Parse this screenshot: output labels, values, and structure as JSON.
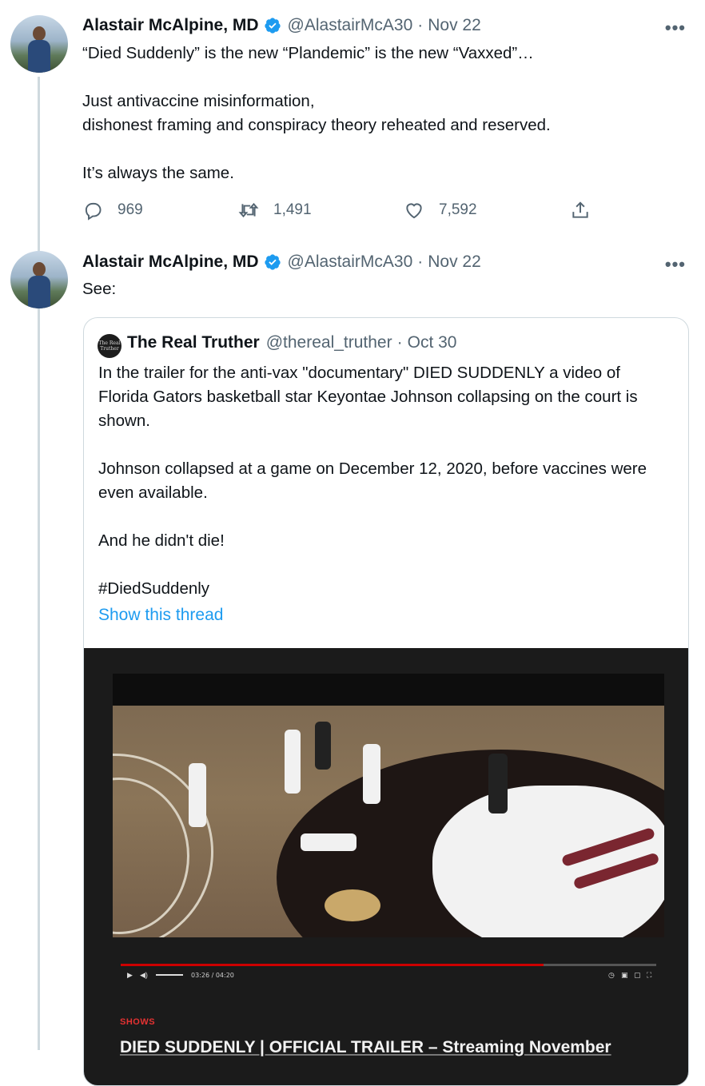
{
  "colors": {
    "accent": "#1d9bf0",
    "text": "#0f1419",
    "secondary": "#536471",
    "thread_line": "#cfd9de",
    "media_bg": "#1b1b1b",
    "card_label": "#e63232"
  },
  "tweets": [
    {
      "author_name": "Alastair McAlpine, MD",
      "verified_icon": "verified-badge-icon",
      "handle": "@AlastairMcA30",
      "separator": "·",
      "date": "Nov 22",
      "more_label": "•••",
      "text": "“Died Suddenly” is the new “Plandemic” is the new “Vaxxed”…\n\nJust antivaccine misinformation,\ndishonest framing and conspiracy theory reheated and reserved.\n\nIt’s always the same.",
      "actions": {
        "reply": {
          "icon": "reply-icon",
          "count": "969"
        },
        "retweet": {
          "icon": "retweet-icon",
          "count": "1,491"
        },
        "like": {
          "icon": "heart-icon",
          "count": "7,592"
        },
        "share": {
          "icon": "share-icon"
        }
      }
    },
    {
      "author_name": "Alastair McAlpine, MD",
      "verified_icon": "verified-badge-icon",
      "handle": "@AlastairMcA30",
      "separator": "·",
      "date": "Nov 22",
      "more_label": "•••",
      "text": "See:"
    }
  ],
  "quoted_tweet": {
    "avatar_text": "The Real Truther",
    "author_name": "The Real Truther",
    "handle": "@thereal_truther",
    "separator": "·",
    "date": "Oct 30",
    "text": "In the trailer for the anti-vax \"documentary\" DIED SUDDENLY a video of Florida Gators basketball star Keyontae Johnson collapsing on the court is shown.\n\nJohnson collapsed at a game on December 12, 2020, before vaccines were even available.\n\nAnd he didn't die!\n\n#DiedSuddenly",
    "show_thread": "Show this thread",
    "media": {
      "video_time": "03:26 / 04:20",
      "progress": 0.79,
      "card_label": "SHOWS",
      "card_title": "DIED SUDDENLY | OFFICIAL TRAILER – Streaming November"
    }
  }
}
